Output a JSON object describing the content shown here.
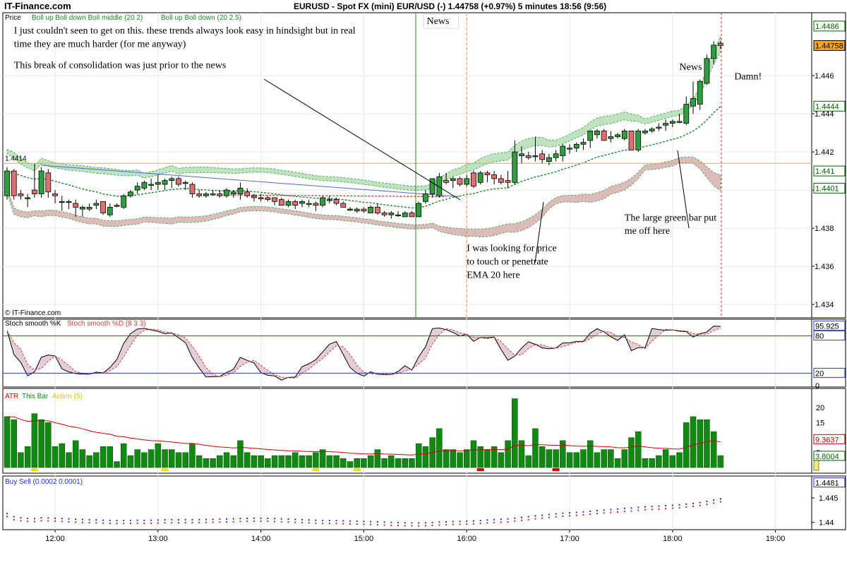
{
  "chart_data": {
    "type": "candlestick",
    "brand": "IT-Finance.com",
    "watermark": "© IT-Finance.com",
    "title": "EURUSD - Spot FX (mini) EUR/USD (-)   1.44758 (+0.97%)   5 minutes   18:56 (9:56)",
    "x_ticks": [
      "12:00",
      "13:00",
      "14:00",
      "15:00",
      "16:00",
      "17:00",
      "18:00",
      "19:00"
    ],
    "price_panel": {
      "label": "Price",
      "indicator_label_1": "Boll up Boll down Boll middle (20 2)",
      "indicator_label_2": "Boll up Boll down (20 2.5)",
      "y_ticks": [
        "1.446",
        "1.444",
        "1.442",
        "1.440",
        "1.438",
        "1.436",
        "1.434"
      ],
      "ylim": [
        1.4333,
        1.4493
      ],
      "level_line": 1.4414,
      "level_label": "1.4414",
      "right_labels": [
        {
          "text": "1.4486",
          "color": "#006400",
          "bg": "#ffffff",
          "value": 1.4486
        },
        {
          "text": "1.44758",
          "color": "#000000",
          "bg": "#f5a623",
          "value": 1.44758
        },
        {
          "text": "1.4444",
          "color": "#006400",
          "bg": "#ffffff",
          "value": 1.4444
        },
        {
          "text": "1.441",
          "color": "#006400",
          "bg": "#ffffff",
          "value": 1.441
        },
        {
          "text": "1.4401",
          "color": "#006400",
          "bg": "#ffffff",
          "value": 1.4401
        }
      ],
      "candles": [
        {
          "o": 1.4397,
          "h": 1.4412,
          "l": 1.4395,
          "c": 1.441
        },
        {
          "o": 1.441,
          "h": 1.4411,
          "l": 1.4395,
          "c": 1.4397
        },
        {
          "o": 1.4398,
          "h": 1.44,
          "l": 1.4395,
          "c": 1.4397
        },
        {
          "o": 1.4396,
          "h": 1.4398,
          "l": 1.4391,
          "c": 1.4396
        },
        {
          "o": 1.44,
          "h": 1.4414,
          "l": 1.4396,
          "c": 1.4398
        },
        {
          "o": 1.4398,
          "h": 1.4412,
          "l": 1.4396,
          "c": 1.441
        },
        {
          "o": 1.4409,
          "h": 1.4411,
          "l": 1.4396,
          "c": 1.4399
        },
        {
          "o": 1.4398,
          "h": 1.44,
          "l": 1.4393,
          "c": 1.4397
        },
        {
          "o": 1.4394,
          "h": 1.4397,
          "l": 1.4389,
          "c": 1.4394
        },
        {
          "o": 1.4394,
          "h": 1.4395,
          "l": 1.439,
          "c": 1.4394
        },
        {
          "o": 1.4393,
          "h": 1.4395,
          "l": 1.4386,
          "c": 1.4391
        },
        {
          "o": 1.439,
          "h": 1.4392,
          "l": 1.4386,
          "c": 1.4391
        },
        {
          "o": 1.439,
          "h": 1.4393,
          "l": 1.4389,
          "c": 1.4391
        },
        {
          "o": 1.4392,
          "h": 1.4395,
          "l": 1.439,
          "c": 1.4393
        },
        {
          "o": 1.4394,
          "h": 1.4394,
          "l": 1.4387,
          "c": 1.4388
        },
        {
          "o": 1.4387,
          "h": 1.4393,
          "l": 1.4386,
          "c": 1.4391
        },
        {
          "o": 1.4392,
          "h": 1.4393,
          "l": 1.4391,
          "c": 1.4392
        },
        {
          "o": 1.4391,
          "h": 1.4398,
          "l": 1.439,
          "c": 1.4397
        },
        {
          "o": 1.4397,
          "h": 1.44,
          "l": 1.4396,
          "c": 1.4399
        },
        {
          "o": 1.44,
          "h": 1.4404,
          "l": 1.4398,
          "c": 1.4402
        },
        {
          "o": 1.4401,
          "h": 1.4405,
          "l": 1.44,
          "c": 1.4404
        },
        {
          "o": 1.4403,
          "h": 1.4406,
          "l": 1.44,
          "c": 1.4403
        },
        {
          "o": 1.4403,
          "h": 1.4408,
          "l": 1.44,
          "c": 1.4404
        },
        {
          "o": 1.4403,
          "h": 1.4406,
          "l": 1.44,
          "c": 1.4405
        },
        {
          "o": 1.4405,
          "h": 1.4407,
          "l": 1.4401,
          "c": 1.4406
        },
        {
          "o": 1.4406,
          "h": 1.4407,
          "l": 1.4402,
          "c": 1.4403
        },
        {
          "o": 1.4404,
          "h": 1.4405,
          "l": 1.44,
          "c": 1.4404
        },
        {
          "o": 1.4403,
          "h": 1.4404,
          "l": 1.4396,
          "c": 1.4398
        },
        {
          "o": 1.4398,
          "h": 1.44,
          "l": 1.4396,
          "c": 1.4397
        },
        {
          "o": 1.4397,
          "h": 1.4399,
          "l": 1.4396,
          "c": 1.4398
        },
        {
          "o": 1.4398,
          "h": 1.44,
          "l": 1.4397,
          "c": 1.4398
        },
        {
          "o": 1.4398,
          "h": 1.44,
          "l": 1.4396,
          "c": 1.4397
        },
        {
          "o": 1.4397,
          "h": 1.4401,
          "l": 1.4396,
          "c": 1.44
        },
        {
          "o": 1.4398,
          "h": 1.44,
          "l": 1.4396,
          "c": 1.4399
        },
        {
          "o": 1.4398,
          "h": 1.4404,
          "l": 1.4395,
          "c": 1.4401
        },
        {
          "o": 1.4399,
          "h": 1.4401,
          "l": 1.4396,
          "c": 1.4397
        },
        {
          "o": 1.4397,
          "h": 1.4398,
          "l": 1.4394,
          "c": 1.4396
        },
        {
          "o": 1.4396,
          "h": 1.4398,
          "l": 1.4394,
          "c": 1.4396
        },
        {
          "o": 1.4396,
          "h": 1.4397,
          "l": 1.4394,
          "c": 1.4395
        },
        {
          "o": 1.4396,
          "h": 1.4396,
          "l": 1.4392,
          "c": 1.4394
        },
        {
          "o": 1.4395,
          "h": 1.4396,
          "l": 1.4392,
          "c": 1.4392
        },
        {
          "o": 1.4392,
          "h": 1.4395,
          "l": 1.4391,
          "c": 1.4394
        },
        {
          "o": 1.4394,
          "h": 1.4395,
          "l": 1.439,
          "c": 1.4392
        },
        {
          "o": 1.4393,
          "h": 1.4395,
          "l": 1.4391,
          "c": 1.4394
        },
        {
          "o": 1.4393,
          "h": 1.4395,
          "l": 1.4391,
          "c": 1.4393
        },
        {
          "o": 1.4393,
          "h": 1.4394,
          "l": 1.4389,
          "c": 1.4392
        },
        {
          "o": 1.4392,
          "h": 1.4397,
          "l": 1.4391,
          "c": 1.4396
        },
        {
          "o": 1.4395,
          "h": 1.4397,
          "l": 1.4393,
          "c": 1.4395
        },
        {
          "o": 1.4395,
          "h": 1.4396,
          "l": 1.4392,
          "c": 1.4393
        },
        {
          "o": 1.4393,
          "h": 1.4394,
          "l": 1.4391,
          "c": 1.4391
        },
        {
          "o": 1.439,
          "h": 1.4391,
          "l": 1.4389,
          "c": 1.439
        },
        {
          "o": 1.4389,
          "h": 1.4391,
          "l": 1.4388,
          "c": 1.439
        },
        {
          "o": 1.439,
          "h": 1.4391,
          "l": 1.4388,
          "c": 1.4389
        },
        {
          "o": 1.4388,
          "h": 1.4392,
          "l": 1.4388,
          "c": 1.4391
        },
        {
          "o": 1.4391,
          "h": 1.4393,
          "l": 1.4387,
          "c": 1.4388
        },
        {
          "o": 1.4388,
          "h": 1.4389,
          "l": 1.4386,
          "c": 1.4387
        },
        {
          "o": 1.4387,
          "h": 1.4389,
          "l": 1.4385,
          "c": 1.4388
        },
        {
          "o": 1.4387,
          "h": 1.4389,
          "l": 1.4386,
          "c": 1.4387
        },
        {
          "o": 1.4386,
          "h": 1.4389,
          "l": 1.4386,
          "c": 1.4388
        },
        {
          "o": 1.4388,
          "h": 1.4389,
          "l": 1.4386,
          "c": 1.4386
        },
        {
          "o": 1.4386,
          "h": 1.4394,
          "l": 1.4386,
          "c": 1.4393
        },
        {
          "o": 1.4394,
          "h": 1.44,
          "l": 1.4393,
          "c": 1.4398
        },
        {
          "o": 1.4398,
          "h": 1.4406,
          "l": 1.4396,
          "c": 1.4406
        },
        {
          "o": 1.4397,
          "h": 1.4409,
          "l": 1.4396,
          "c": 1.4407
        },
        {
          "o": 1.4405,
          "h": 1.4409,
          "l": 1.4403,
          "c": 1.4404
        },
        {
          "o": 1.4405,
          "h": 1.4407,
          "l": 1.4401,
          "c": 1.4406
        },
        {
          "o": 1.4406,
          "h": 1.4407,
          "l": 1.4402,
          "c": 1.4403
        },
        {
          "o": 1.4403,
          "h": 1.4408,
          "l": 1.4402,
          "c": 1.4406
        },
        {
          "o": 1.4409,
          "h": 1.441,
          "l": 1.4401,
          "c": 1.4402
        },
        {
          "o": 1.4404,
          "h": 1.441,
          "l": 1.4403,
          "c": 1.4409
        },
        {
          "o": 1.4409,
          "h": 1.441,
          "l": 1.4404,
          "c": 1.4408
        },
        {
          "o": 1.4408,
          "h": 1.441,
          "l": 1.4403,
          "c": 1.4406
        },
        {
          "o": 1.4406,
          "h": 1.4408,
          "l": 1.4403,
          "c": 1.4404
        },
        {
          "o": 1.4405,
          "h": 1.441,
          "l": 1.4401,
          "c": 1.4404
        },
        {
          "o": 1.4404,
          "h": 1.4426,
          "l": 1.4403,
          "c": 1.442
        },
        {
          "o": 1.4418,
          "h": 1.4423,
          "l": 1.4414,
          "c": 1.4419
        },
        {
          "o": 1.4418,
          "h": 1.442,
          "l": 1.4416,
          "c": 1.4417
        },
        {
          "o": 1.4418,
          "h": 1.4428,
          "l": 1.4415,
          "c": 1.4418
        },
        {
          "o": 1.4419,
          "h": 1.4421,
          "l": 1.4414,
          "c": 1.4416
        },
        {
          "o": 1.4415,
          "h": 1.4419,
          "l": 1.4413,
          "c": 1.4417
        },
        {
          "o": 1.4417,
          "h": 1.4421,
          "l": 1.4415,
          "c": 1.4419
        },
        {
          "o": 1.4418,
          "h": 1.4424,
          "l": 1.4415,
          "c": 1.4423
        },
        {
          "o": 1.4422,
          "h": 1.4424,
          "l": 1.4419,
          "c": 1.4422
        },
        {
          "o": 1.4422,
          "h": 1.4425,
          "l": 1.442,
          "c": 1.4424
        },
        {
          "o": 1.4424,
          "h": 1.4427,
          "l": 1.4421,
          "c": 1.4425
        },
        {
          "o": 1.4426,
          "h": 1.4431,
          "l": 1.4422,
          "c": 1.4431
        },
        {
          "o": 1.4429,
          "h": 1.4432,
          "l": 1.4427,
          "c": 1.4431
        },
        {
          "o": 1.4431,
          "h": 1.4432,
          "l": 1.4426,
          "c": 1.4426
        },
        {
          "o": 1.4427,
          "h": 1.4431,
          "l": 1.4425,
          "c": 1.4428
        },
        {
          "o": 1.4428,
          "h": 1.443,
          "l": 1.4427,
          "c": 1.4429
        },
        {
          "o": 1.4427,
          "h": 1.4432,
          "l": 1.4426,
          "c": 1.4431
        },
        {
          "o": 1.4431,
          "h": 1.4431,
          "l": 1.4421,
          "c": 1.4421
        },
        {
          "o": 1.4421,
          "h": 1.4432,
          "l": 1.442,
          "c": 1.4431
        },
        {
          "o": 1.443,
          "h": 1.4432,
          "l": 1.4429,
          "c": 1.4431
        },
        {
          "o": 1.4431,
          "h": 1.4433,
          "l": 1.443,
          "c": 1.4432
        },
        {
          "o": 1.4433,
          "h": 1.4435,
          "l": 1.4431,
          "c": 1.4433
        },
        {
          "o": 1.4434,
          "h": 1.4437,
          "l": 1.4431,
          "c": 1.4435
        },
        {
          "o": 1.4435,
          "h": 1.4437,
          "l": 1.4433,
          "c": 1.4436
        },
        {
          "o": 1.4436,
          "h": 1.444,
          "l": 1.4435,
          "c": 1.4436
        },
        {
          "o": 1.4435,
          "h": 1.4449,
          "l": 1.4434,
          "c": 1.4445
        },
        {
          "o": 1.4444,
          "h": 1.4457,
          "l": 1.444,
          "c": 1.4448
        },
        {
          "o": 1.4445,
          "h": 1.4458,
          "l": 1.4442,
          "c": 1.4457
        },
        {
          "o": 1.4456,
          "h": 1.4471,
          "l": 1.4455,
          "c": 1.4469
        },
        {
          "o": 1.4469,
          "h": 1.4478,
          "l": 1.4466,
          "c": 1.4476
        },
        {
          "o": 1.4477,
          "h": 1.4478,
          "l": 1.4474,
          "c": 1.44758
        }
      ],
      "annotations": [
        {
          "text": "I just couldn't seen to get on this.  these trends always look easy in hindsight but in real",
          "x_idx": 1,
          "price": 1.4482
        },
        {
          "text": "time they are much harder (for me anyway)",
          "x_idx": 1,
          "price": 1.4475
        },
        {
          "text": "This break of consolidation was just prior to the news",
          "x_idx": 1,
          "price": 1.4464
        },
        {
          "text": "News",
          "x_idx": 62,
          "price": 1.4487,
          "boxed": true
        },
        {
          "text": "News",
          "x_idx": 98,
          "price": 1.4463
        },
        {
          "text": "Damn!",
          "x_idx": 106,
          "price": 1.4458
        },
        {
          "text": "I was looking for price",
          "x_idx": 67,
          "price": 1.4368
        },
        {
          "text": "to touch or penetrate",
          "x_idx": 67,
          "price": 1.4361
        },
        {
          "text": "EMA 20 here",
          "x_idx": 67,
          "price": 1.4354
        },
        {
          "text": "The large green bar put",
          "x_idx": 90,
          "price": 1.4384
        },
        {
          "text": "me off here",
          "x_idx": 90,
          "price": 1.4377
        }
      ]
    },
    "stoch_panel": {
      "label_k": "Stoch smooth %K",
      "label_d": "Stoch smooth %D (8 3 3)",
      "ylim": [
        0,
        100
      ],
      "levels": [
        20,
        80
      ],
      "right_labels": [
        {
          "text": "95.925",
          "value": 95.925
        },
        {
          "text": "80",
          "value": 80
        },
        {
          "text": "20",
          "value": 20
        },
        {
          "text": "0",
          "value": 0
        }
      ]
    },
    "atr_panel": {
      "label_atr": "ATR",
      "label_bar": "This Bar",
      "label_action": "Action (5)",
      "ylim": [
        0,
        25
      ],
      "y_ticks": [
        "20",
        "15",
        "10",
        "5"
      ],
      "right_labels": [
        {
          "text": "9.3637",
          "value": 9.3637,
          "color": "#cc0000"
        },
        {
          "text": "3.8004",
          "value": 3.8004,
          "color": "#006400"
        }
      ]
    },
    "buysell_panel": {
      "label": "Buy Sell (0.0002 0.0001)",
      "ylim": [
        1.4385,
        1.4495
      ],
      "y_ticks": [
        "1.445",
        "1.44"
      ],
      "right_labels": [
        {
          "text": "1.4481",
          "value": 1.4481
        }
      ]
    },
    "colors": {
      "up": "#2e9e3e",
      "down": "#e07070",
      "band_green": "#b5dfb5",
      "band_red": "#d9b0b0",
      "ema": "#1a8a2a",
      "level": "#f0a060",
      "trend": "#4a6ad8"
    }
  }
}
